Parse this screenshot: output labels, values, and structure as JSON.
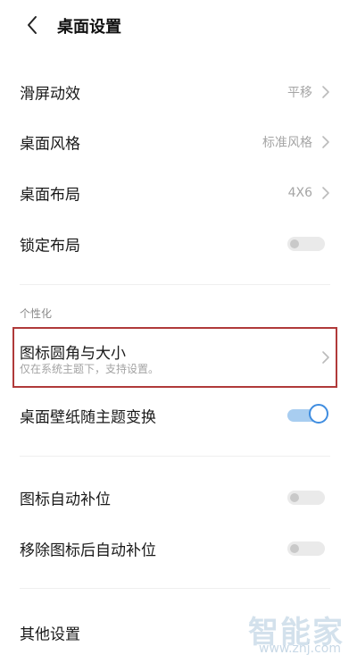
{
  "header": {
    "title": "桌面设置"
  },
  "rows": {
    "slide_effect": {
      "label": "滑屏动效",
      "value": "平移"
    },
    "desktop_style": {
      "label": "桌面风格",
      "value": "标准风格"
    },
    "desktop_layout": {
      "label": "桌面布局",
      "value": "4X6"
    },
    "lock_layout": {
      "label": "锁定布局",
      "enabled": false
    }
  },
  "personalization": {
    "section_title": "个性化",
    "icon_corner": {
      "label": "图标圆角与大小",
      "subtitle": "仅在系统主题下，支持设置。"
    },
    "wallpaper_follow": {
      "label": "桌面壁纸随主题变换",
      "enabled": true
    }
  },
  "auto": {
    "icon_autofill": {
      "label": "图标自动补位",
      "enabled": false
    },
    "remove_autofill": {
      "label": "移除图标后自动补位",
      "enabled": false
    }
  },
  "other": {
    "label": "其他设置"
  },
  "watermark": {
    "brand": "智能家",
    "url": "www.znj.com"
  },
  "colors": {
    "accent": "#3f8de0",
    "highlight_border": "#b03a3a"
  }
}
